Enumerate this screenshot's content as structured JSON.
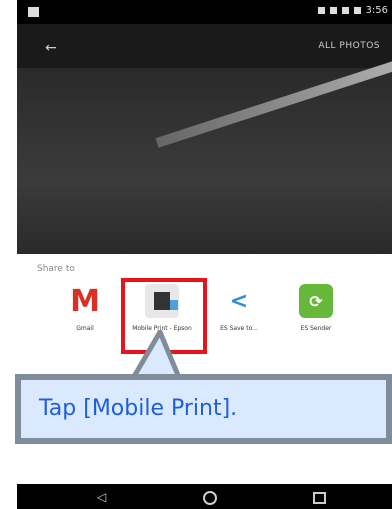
{
  "status_bar": {
    "time": "3:56"
  },
  "top_bar": {
    "all_photos": "ALL PHOTOS"
  },
  "share_sheet": {
    "title": "Share to",
    "apps": [
      {
        "label": "Gmail",
        "icon": "gmail-icon"
      },
      {
        "label": "Mobile Print - Epson",
        "icon": "mobile-print-icon"
      },
      {
        "label": "ES Save to...",
        "icon": "es-save-icon"
      },
      {
        "label": "ES Sender",
        "icon": "es-sender-icon"
      }
    ]
  },
  "callout": {
    "text": "Tap [Mobile Print]."
  },
  "colors": {
    "highlight": "#e8141b",
    "callout_bg": "#dbe9ff",
    "callout_text": "#1f5fd6",
    "callout_border": "#7f8c99"
  }
}
